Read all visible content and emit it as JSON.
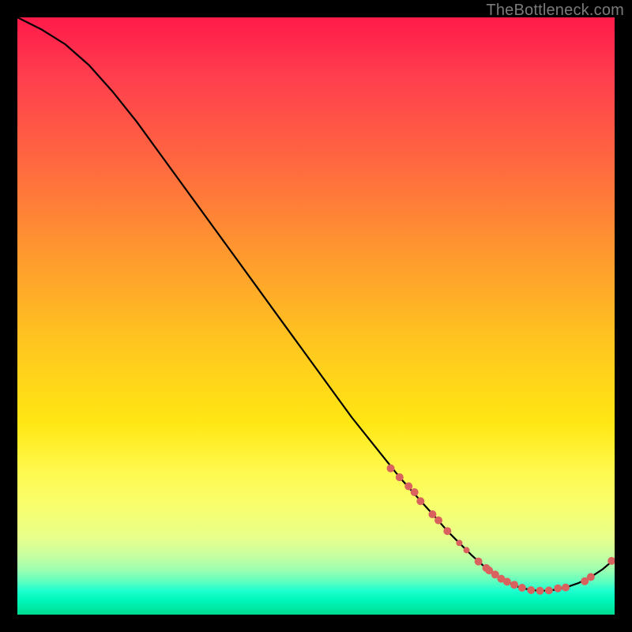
{
  "attribution": "TheBottleneck.com",
  "chart_data": {
    "type": "line",
    "title": "",
    "xlabel": "",
    "ylabel": "",
    "xlim": [
      0,
      100
    ],
    "ylim": [
      0,
      100
    ],
    "series": [
      {
        "name": "curve",
        "x": [
          0,
          4,
          8,
          12,
          16,
          20,
          24,
          28,
          32,
          36,
          40,
          44,
          48,
          52,
          56,
          60,
          64,
          68,
          70,
          72,
          74,
          76,
          78,
          80,
          82,
          84,
          86,
          88,
          90,
          92,
          94,
          96,
          98,
          100
        ],
        "values": [
          100,
          98,
          95.5,
          92,
          87.5,
          82.5,
          77,
          71.5,
          66,
          60.5,
          55,
          49.5,
          44,
          38.5,
          33,
          28,
          23,
          18.5,
          16.3,
          14,
          12,
          10,
          8.2,
          6.7,
          5.5,
          4.6,
          4.1,
          4.0,
          4.15,
          4.6,
          5.3,
          6.3,
          7.6,
          9.3
        ]
      }
    ],
    "markers": {
      "name": "points",
      "color": "#d9625e",
      "points": [
        {
          "x": 62.5,
          "y": 24.5,
          "r": 5
        },
        {
          "x": 64.0,
          "y": 23.0,
          "r": 5
        },
        {
          "x": 65.5,
          "y": 21.5,
          "r": 5
        },
        {
          "x": 66.5,
          "y": 20.5,
          "r": 5
        },
        {
          "x": 67.5,
          "y": 19.0,
          "r": 5
        },
        {
          "x": 69.5,
          "y": 16.8,
          "r": 5
        },
        {
          "x": 70.5,
          "y": 15.8,
          "r": 5
        },
        {
          "x": 72.0,
          "y": 14.0,
          "r": 5
        },
        {
          "x": 74.0,
          "y": 12.0,
          "r": 4
        },
        {
          "x": 75.2,
          "y": 10.8,
          "r": 4
        },
        {
          "x": 77.2,
          "y": 8.9,
          "r": 5
        },
        {
          "x": 78.5,
          "y": 7.8,
          "r": 5
        },
        {
          "x": 79.0,
          "y": 7.4,
          "r": 5
        },
        {
          "x": 80.0,
          "y": 6.7,
          "r": 5
        },
        {
          "x": 81.0,
          "y": 6.0,
          "r": 5
        },
        {
          "x": 82.0,
          "y": 5.5,
          "r": 5
        },
        {
          "x": 83.2,
          "y": 5.0,
          "r": 5
        },
        {
          "x": 84.5,
          "y": 4.5,
          "r": 5
        },
        {
          "x": 86.0,
          "y": 4.1,
          "r": 5
        },
        {
          "x": 87.5,
          "y": 4.0,
          "r": 5
        },
        {
          "x": 89.0,
          "y": 4.05,
          "r": 5
        },
        {
          "x": 90.5,
          "y": 4.4,
          "r": 5
        },
        {
          "x": 91.8,
          "y": 4.55,
          "r": 5
        },
        {
          "x": 95.0,
          "y": 5.6,
          "r": 5
        },
        {
          "x": 96.0,
          "y": 6.3,
          "r": 5
        },
        {
          "x": 99.5,
          "y": 9.0,
          "r": 5
        }
      ]
    }
  }
}
